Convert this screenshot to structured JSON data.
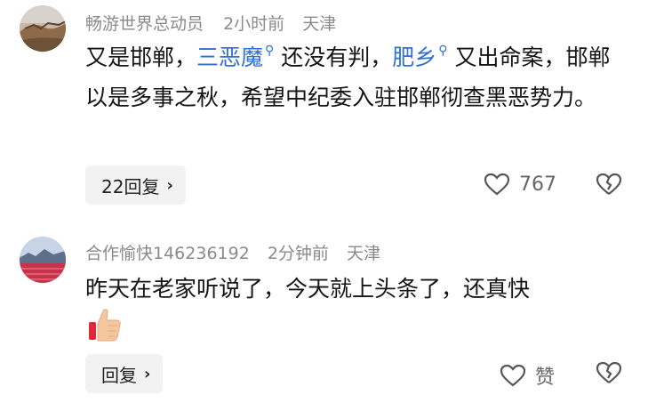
{
  "comments": [
    {
      "user": "畅游世界总动员",
      "time": "2小时前",
      "location": "天津",
      "text_parts": [
        "又是邯郸，",
        "三恶魔",
        "还没有判，",
        "肥乡",
        "又出命案，邯郸以是多事之秋，希望中纪委入驻邯郸彻查黑恶势力。"
      ],
      "reply_label": "22回复",
      "likes": "767"
    },
    {
      "user": "合作愉快146236192",
      "time": "2分钟前",
      "location": "天津",
      "text": "昨天在老家听说了，今天就上头条了，还真快",
      "reply_label": "回复",
      "likes": "赞"
    }
  ],
  "icons": [
    "heart-icon",
    "broken-heart-icon",
    "thumbs-up-emoji",
    "search-lens-icon",
    "chevron-right-icon"
  ],
  "colors": {
    "link": "#2f6fd6",
    "meta": "#8a8a8a",
    "button_bg": "#f2f2f2"
  }
}
